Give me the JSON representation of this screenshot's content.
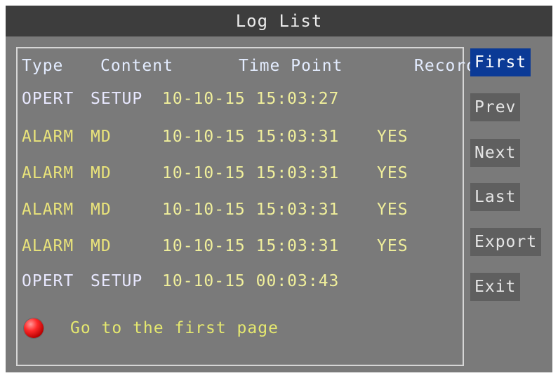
{
  "window": {
    "title": "Log List"
  },
  "table": {
    "headers": [
      "Type",
      "Content",
      "Time Point",
      "Record"
    ],
    "rows": [
      {
        "type": "OPERT",
        "content": "SETUP",
        "time": "10-10-15 15:03:27",
        "record": ""
      },
      {
        "type": "ALARM",
        "content": "MD",
        "time": "10-10-15 15:03:31",
        "record": "YES"
      },
      {
        "type": "ALARM",
        "content": "MD",
        "time": "10-10-15 15:03:31",
        "record": "YES"
      },
      {
        "type": "ALARM",
        "content": "MD",
        "time": "10-10-15 15:03:31",
        "record": "YES"
      },
      {
        "type": "ALARM",
        "content": "MD",
        "time": "10-10-15 15:03:31",
        "record": "YES"
      },
      {
        "type": "OPERT",
        "content": "SETUP",
        "time": "10-10-15 00:03:43",
        "record": ""
      }
    ]
  },
  "nav_buttons": [
    {
      "id": "first",
      "label": "First",
      "selected": true
    },
    {
      "id": "prev",
      "label": "Prev",
      "selected": false
    },
    {
      "id": "next",
      "label": "Next",
      "selected": false
    },
    {
      "id": "last",
      "label": "Last",
      "selected": false
    },
    {
      "id": "export",
      "label": "Export",
      "selected": false
    },
    {
      "id": "exit",
      "label": "Exit",
      "selected": false
    }
  ],
  "status": {
    "icon": "red-dot-icon",
    "message": "Go to the first page"
  },
  "colors": {
    "selected_button": "#0b3a96",
    "button_background": "#5f5f5f",
    "status_dot": "#ff2a2a"
  }
}
